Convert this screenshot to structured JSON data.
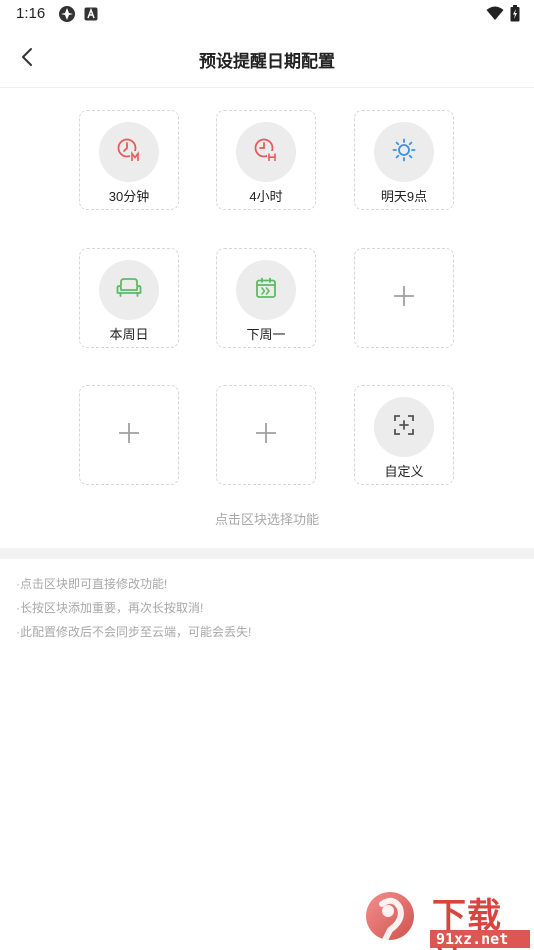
{
  "status_bar": {
    "time": "1:16"
  },
  "header": {
    "title": "预设提醒日期配置"
  },
  "tiles": [
    {
      "label": "30分钟",
      "icon": "clock-m-icon",
      "color": "#e8595a"
    },
    {
      "label": "4小时",
      "icon": "clock-h-icon",
      "color": "#e8595a"
    },
    {
      "label": "明天9点",
      "icon": "sun-icon",
      "color": "#3d8fe0"
    },
    {
      "label": "本周日",
      "icon": "sofa-icon",
      "color": "#5dbb63"
    },
    {
      "label": "下周一",
      "icon": "calendar-next-icon",
      "color": "#5dbb63"
    },
    {
      "label": "",
      "icon": "plus-icon",
      "color": "#a0a0a0"
    },
    {
      "label": "",
      "icon": "plus-icon",
      "color": "#a0a0a0"
    },
    {
      "label": "",
      "icon": "plus-icon",
      "color": "#a0a0a0"
    },
    {
      "label": "自定义",
      "icon": "custom-add-icon",
      "color": "#555555"
    }
  ],
  "hint": "点击区块选择功能",
  "notes": [
    "·点击区块即可直接修改功能!",
    "·长按区块添加重要，再次长按取消!",
    "·此配置修改后不会同步至云端，可能会丢失!"
  ],
  "watermark": {
    "logo_text": "下载站",
    "domain_text": "91xz.net"
  }
}
